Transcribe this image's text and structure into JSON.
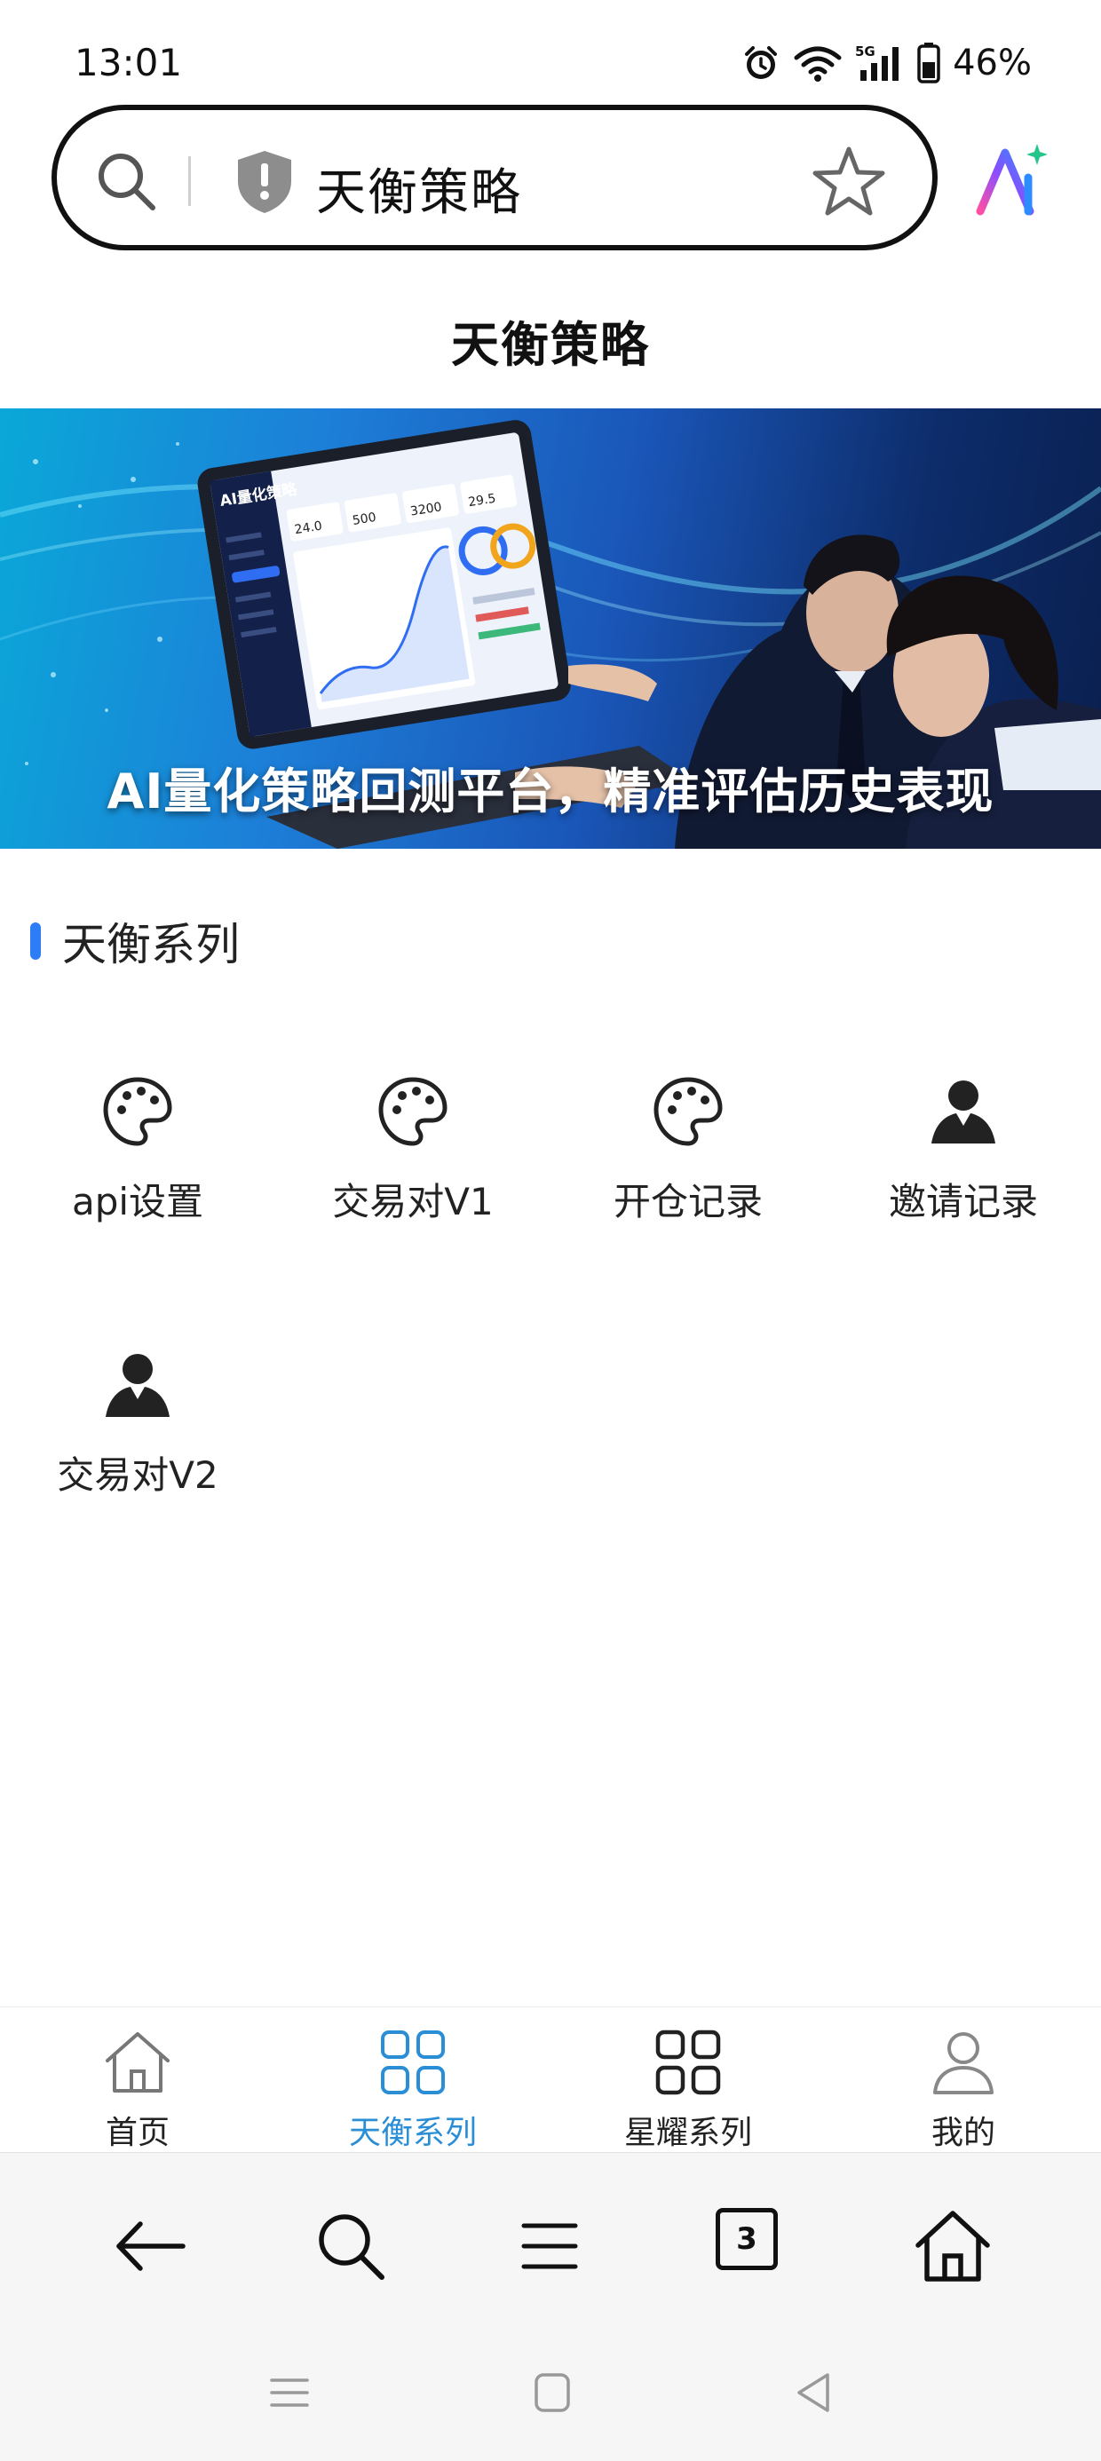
{
  "status_bar": {
    "time": "13:01",
    "network": "5G",
    "battery_percent": "46%",
    "icons": [
      "alarm-icon",
      "wifi-icon",
      "cellular-signal-icon",
      "battery-icon"
    ]
  },
  "browser": {
    "address_text": "天衡策略",
    "open_tabs_count": "3",
    "icons": [
      "search-icon",
      "shield-warning-icon",
      "star-icon",
      "ai-assistant-icon"
    ]
  },
  "page": {
    "title": "天衡策略",
    "banner": {
      "caption": "AI量化策略回测平台，精准评估历史表现",
      "laptop_brand": "AI量化策略",
      "stat_a": "24.0",
      "stat_b": "500",
      "stat_c": "3200",
      "stat_d": "29.5"
    },
    "section": {
      "title": "天衡系列",
      "accent_color": "#2f7df6"
    },
    "grid": [
      {
        "label": "api设置",
        "icon": "palette-icon"
      },
      {
        "label": "交易对V1",
        "icon": "palette-icon"
      },
      {
        "label": "开仓记录",
        "icon": "palette-icon"
      },
      {
        "label": "邀请记录",
        "icon": "user-icon"
      },
      {
        "label": "交易对V2",
        "icon": "user-icon"
      }
    ]
  },
  "tab_bar": {
    "active_color": "#2a8ed6",
    "tabs": [
      {
        "label": "首页",
        "icon": "home-icon",
        "active": false
      },
      {
        "label": "天衡系列",
        "icon": "grid-icon",
        "active": true
      },
      {
        "label": "星耀系列",
        "icon": "grid-icon",
        "active": false
      },
      {
        "label": "我的",
        "icon": "user-outline-icon",
        "active": false
      }
    ]
  },
  "browser_nav": {
    "icons": [
      "back-arrow-icon",
      "search-icon",
      "menu-icon",
      "tabs-icon",
      "home-icon"
    ]
  },
  "system_nav": {
    "icons": [
      "recent-apps-icon",
      "home-square-icon",
      "back-triangle-icon"
    ]
  }
}
